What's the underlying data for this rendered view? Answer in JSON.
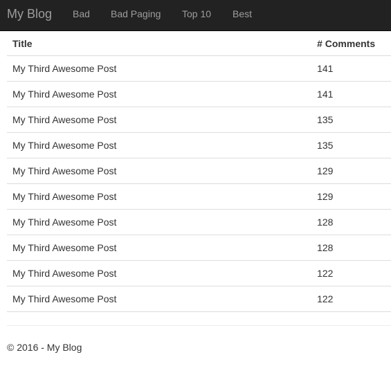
{
  "navbar": {
    "brand": "My Blog",
    "links": [
      {
        "label": "Bad"
      },
      {
        "label": "Bad Paging"
      },
      {
        "label": "Top 10"
      },
      {
        "label": "Best"
      }
    ]
  },
  "table": {
    "headers": {
      "title": "Title",
      "comments": "# Comments"
    },
    "rows": [
      {
        "title": "My Third Awesome Post",
        "comments": "141"
      },
      {
        "title": "My Third Awesome Post",
        "comments": "141"
      },
      {
        "title": "My Third Awesome Post",
        "comments": "135"
      },
      {
        "title": "My Third Awesome Post",
        "comments": "135"
      },
      {
        "title": "My Third Awesome Post",
        "comments": "129"
      },
      {
        "title": "My Third Awesome Post",
        "comments": "129"
      },
      {
        "title": "My Third Awesome Post",
        "comments": "128"
      },
      {
        "title": "My Third Awesome Post",
        "comments": "128"
      },
      {
        "title": "My Third Awesome Post",
        "comments": "122"
      },
      {
        "title": "My Third Awesome Post",
        "comments": "122"
      }
    ]
  },
  "footer": {
    "text": "© 2016 - My Blog"
  },
  "colors": {
    "navbar_bg": "#222222",
    "navbar_text": "#9d9d9d",
    "row_border": "#dddddd",
    "body_text": "#333333"
  }
}
